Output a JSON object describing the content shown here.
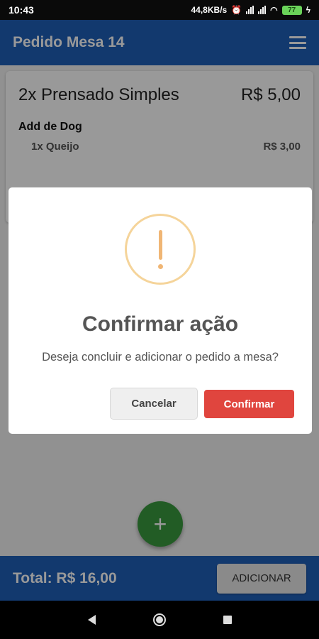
{
  "status_bar": {
    "time": "10:43",
    "network_speed": "44,8KB/s",
    "battery": "77"
  },
  "app_bar": {
    "title": "Pedido Mesa 14",
    "menu_icon": "hamburger-menu-icon"
  },
  "order": {
    "item": {
      "name": "2x Prensado Simples",
      "price": "R$ 5,00"
    },
    "addon_group": "Add de Dog",
    "addons": [
      {
        "name": "1x Queijo",
        "price": "R$ 3,00"
      }
    ]
  },
  "fab": {
    "label": "+"
  },
  "footer": {
    "total": "Total: R$ 16,00",
    "add_label": "ADICIONAR"
  },
  "dialog": {
    "icon": "warning-icon",
    "title": "Confirmar ação",
    "message": "Deseja concluir e adicionar o pedido a mesa?",
    "cancel_label": "Cancelar",
    "confirm_label": "Confirmar"
  },
  "colors": {
    "primary": "#1f5fb7",
    "fab": "#3a9a3f",
    "confirm": "#e0453e",
    "warning": "#f0b675"
  }
}
